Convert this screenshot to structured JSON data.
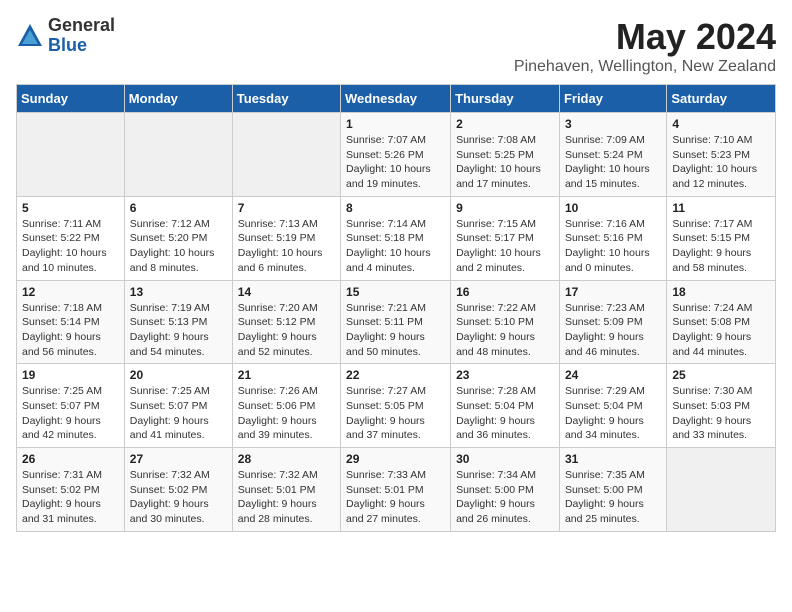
{
  "logo": {
    "general": "General",
    "blue": "Blue"
  },
  "title": "May 2024",
  "location": "Pinehaven, Wellington, New Zealand",
  "weekdays": [
    "Sunday",
    "Monday",
    "Tuesday",
    "Wednesday",
    "Thursday",
    "Friday",
    "Saturday"
  ],
  "weeks": [
    [
      {
        "day": "",
        "sunrise": "",
        "sunset": "",
        "daylight": ""
      },
      {
        "day": "",
        "sunrise": "",
        "sunset": "",
        "daylight": ""
      },
      {
        "day": "",
        "sunrise": "",
        "sunset": "",
        "daylight": ""
      },
      {
        "day": "1",
        "sunrise": "Sunrise: 7:07 AM",
        "sunset": "Sunset: 5:26 PM",
        "daylight": "Daylight: 10 hours and 19 minutes."
      },
      {
        "day": "2",
        "sunrise": "Sunrise: 7:08 AM",
        "sunset": "Sunset: 5:25 PM",
        "daylight": "Daylight: 10 hours and 17 minutes."
      },
      {
        "day": "3",
        "sunrise": "Sunrise: 7:09 AM",
        "sunset": "Sunset: 5:24 PM",
        "daylight": "Daylight: 10 hours and 15 minutes."
      },
      {
        "day": "4",
        "sunrise": "Sunrise: 7:10 AM",
        "sunset": "Sunset: 5:23 PM",
        "daylight": "Daylight: 10 hours and 12 minutes."
      }
    ],
    [
      {
        "day": "5",
        "sunrise": "Sunrise: 7:11 AM",
        "sunset": "Sunset: 5:22 PM",
        "daylight": "Daylight: 10 hours and 10 minutes."
      },
      {
        "day": "6",
        "sunrise": "Sunrise: 7:12 AM",
        "sunset": "Sunset: 5:20 PM",
        "daylight": "Daylight: 10 hours and 8 minutes."
      },
      {
        "day": "7",
        "sunrise": "Sunrise: 7:13 AM",
        "sunset": "Sunset: 5:19 PM",
        "daylight": "Daylight: 10 hours and 6 minutes."
      },
      {
        "day": "8",
        "sunrise": "Sunrise: 7:14 AM",
        "sunset": "Sunset: 5:18 PM",
        "daylight": "Daylight: 10 hours and 4 minutes."
      },
      {
        "day": "9",
        "sunrise": "Sunrise: 7:15 AM",
        "sunset": "Sunset: 5:17 PM",
        "daylight": "Daylight: 10 hours and 2 minutes."
      },
      {
        "day": "10",
        "sunrise": "Sunrise: 7:16 AM",
        "sunset": "Sunset: 5:16 PM",
        "daylight": "Daylight: 10 hours and 0 minutes."
      },
      {
        "day": "11",
        "sunrise": "Sunrise: 7:17 AM",
        "sunset": "Sunset: 5:15 PM",
        "daylight": "Daylight: 9 hours and 58 minutes."
      }
    ],
    [
      {
        "day": "12",
        "sunrise": "Sunrise: 7:18 AM",
        "sunset": "Sunset: 5:14 PM",
        "daylight": "Daylight: 9 hours and 56 minutes."
      },
      {
        "day": "13",
        "sunrise": "Sunrise: 7:19 AM",
        "sunset": "Sunset: 5:13 PM",
        "daylight": "Daylight: 9 hours and 54 minutes."
      },
      {
        "day": "14",
        "sunrise": "Sunrise: 7:20 AM",
        "sunset": "Sunset: 5:12 PM",
        "daylight": "Daylight: 9 hours and 52 minutes."
      },
      {
        "day": "15",
        "sunrise": "Sunrise: 7:21 AM",
        "sunset": "Sunset: 5:11 PM",
        "daylight": "Daylight: 9 hours and 50 minutes."
      },
      {
        "day": "16",
        "sunrise": "Sunrise: 7:22 AM",
        "sunset": "Sunset: 5:10 PM",
        "daylight": "Daylight: 9 hours and 48 minutes."
      },
      {
        "day": "17",
        "sunrise": "Sunrise: 7:23 AM",
        "sunset": "Sunset: 5:09 PM",
        "daylight": "Daylight: 9 hours and 46 minutes."
      },
      {
        "day": "18",
        "sunrise": "Sunrise: 7:24 AM",
        "sunset": "Sunset: 5:08 PM",
        "daylight": "Daylight: 9 hours and 44 minutes."
      }
    ],
    [
      {
        "day": "19",
        "sunrise": "Sunrise: 7:25 AM",
        "sunset": "Sunset: 5:07 PM",
        "daylight": "Daylight: 9 hours and 42 minutes."
      },
      {
        "day": "20",
        "sunrise": "Sunrise: 7:25 AM",
        "sunset": "Sunset: 5:07 PM",
        "daylight": "Daylight: 9 hours and 41 minutes."
      },
      {
        "day": "21",
        "sunrise": "Sunrise: 7:26 AM",
        "sunset": "Sunset: 5:06 PM",
        "daylight": "Daylight: 9 hours and 39 minutes."
      },
      {
        "day": "22",
        "sunrise": "Sunrise: 7:27 AM",
        "sunset": "Sunset: 5:05 PM",
        "daylight": "Daylight: 9 hours and 37 minutes."
      },
      {
        "day": "23",
        "sunrise": "Sunrise: 7:28 AM",
        "sunset": "Sunset: 5:04 PM",
        "daylight": "Daylight: 9 hours and 36 minutes."
      },
      {
        "day": "24",
        "sunrise": "Sunrise: 7:29 AM",
        "sunset": "Sunset: 5:04 PM",
        "daylight": "Daylight: 9 hours and 34 minutes."
      },
      {
        "day": "25",
        "sunrise": "Sunrise: 7:30 AM",
        "sunset": "Sunset: 5:03 PM",
        "daylight": "Daylight: 9 hours and 33 minutes."
      }
    ],
    [
      {
        "day": "26",
        "sunrise": "Sunrise: 7:31 AM",
        "sunset": "Sunset: 5:02 PM",
        "daylight": "Daylight: 9 hours and 31 minutes."
      },
      {
        "day": "27",
        "sunrise": "Sunrise: 7:32 AM",
        "sunset": "Sunset: 5:02 PM",
        "daylight": "Daylight: 9 hours and 30 minutes."
      },
      {
        "day": "28",
        "sunrise": "Sunrise: 7:32 AM",
        "sunset": "Sunset: 5:01 PM",
        "daylight": "Daylight: 9 hours and 28 minutes."
      },
      {
        "day": "29",
        "sunrise": "Sunrise: 7:33 AM",
        "sunset": "Sunset: 5:01 PM",
        "daylight": "Daylight: 9 hours and 27 minutes."
      },
      {
        "day": "30",
        "sunrise": "Sunrise: 7:34 AM",
        "sunset": "Sunset: 5:00 PM",
        "daylight": "Daylight: 9 hours and 26 minutes."
      },
      {
        "day": "31",
        "sunrise": "Sunrise: 7:35 AM",
        "sunset": "Sunset: 5:00 PM",
        "daylight": "Daylight: 9 hours and 25 minutes."
      },
      {
        "day": "",
        "sunrise": "",
        "sunset": "",
        "daylight": ""
      }
    ]
  ]
}
